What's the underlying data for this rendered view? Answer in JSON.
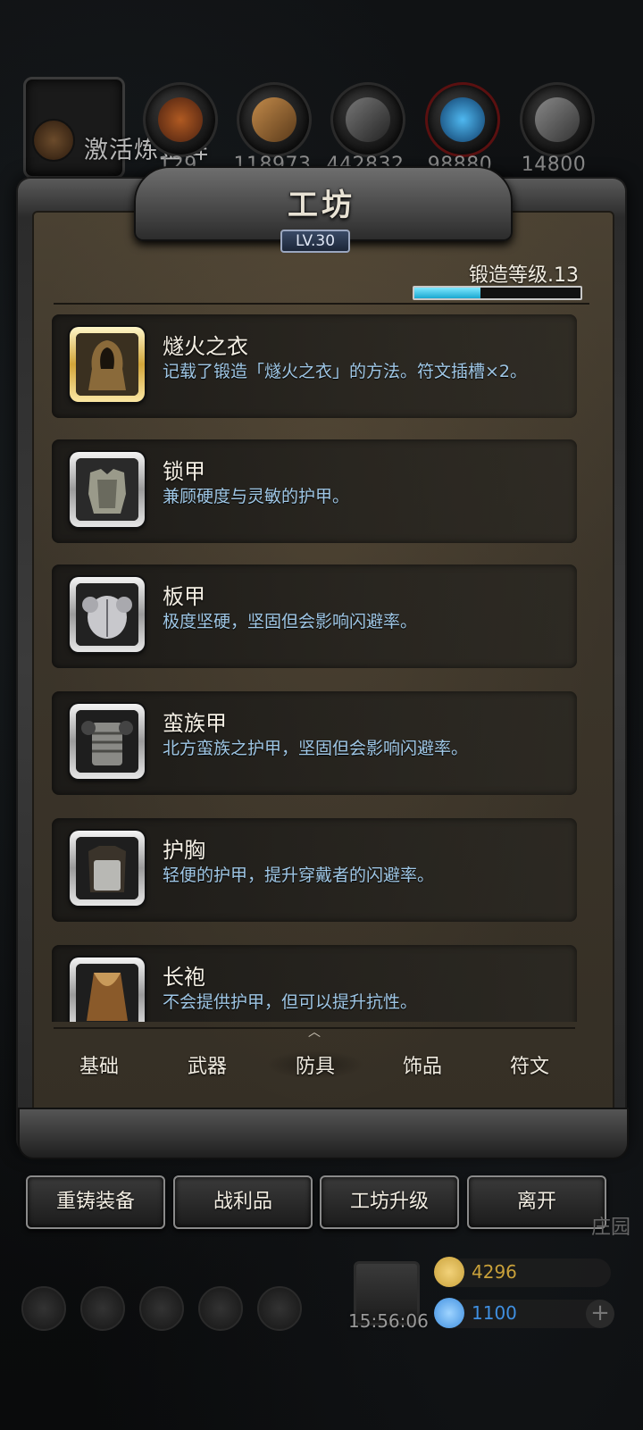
{
  "top_bar": {
    "alchemy_label": "激活炼金阵",
    "resources": [
      {
        "icon": "ore-icon",
        "value": "129"
      },
      {
        "icon": "wood-icon",
        "value": "118973"
      },
      {
        "icon": "iron-icon",
        "value": "442832"
      },
      {
        "icon": "crystal-icon",
        "value": "98880"
      },
      {
        "icon": "steel-icon",
        "value": "14800"
      }
    ]
  },
  "panel": {
    "title": "工坊",
    "level": "LV.30",
    "forge_level_label": "锻造等级.13",
    "forge_progress": 0.4
  },
  "items": [
    {
      "name": "燧火之衣",
      "desc": "记载了锻造「燧火之衣」的方法。符文插槽×2。",
      "frame": "gold",
      "icon": "hooded-cloak-icon"
    },
    {
      "name": "锁甲",
      "desc": "兼顾硬度与灵敏的护甲。",
      "frame": "silver",
      "icon": "chainmail-icon"
    },
    {
      "name": "板甲",
      "desc": "极度坚硬，坚固但会影响闪避率。",
      "frame": "silver",
      "icon": "plate-armor-icon"
    },
    {
      "name": "蛮族甲",
      "desc": "北方蛮族之护甲，坚固但会影响闪避率。",
      "frame": "silver",
      "icon": "barbarian-armor-icon"
    },
    {
      "name": "护胸",
      "desc": "轻便的护甲，提升穿戴者的闪避率。",
      "frame": "silver",
      "icon": "breastplate-icon"
    },
    {
      "name": "长袍",
      "desc": "不会提供护甲，但可以提升抗性。",
      "frame": "silver",
      "icon": "robe-icon"
    }
  ],
  "tabs": [
    {
      "label": "基础",
      "active": false
    },
    {
      "label": "武器",
      "active": false
    },
    {
      "label": "防具",
      "active": true
    },
    {
      "label": "饰品",
      "active": false
    },
    {
      "label": "符文",
      "active": false
    }
  ],
  "buttons": {
    "recast": "重铸装备",
    "loot": "战利品",
    "upgrade": "工坊升级",
    "leave": "离开"
  },
  "hud": {
    "clock": "15:56:06",
    "gold": "4296",
    "gems": "1100",
    "side_text": "庄园",
    "gold_color": "#c9a13a",
    "gem_color": "#3f8fe0"
  }
}
